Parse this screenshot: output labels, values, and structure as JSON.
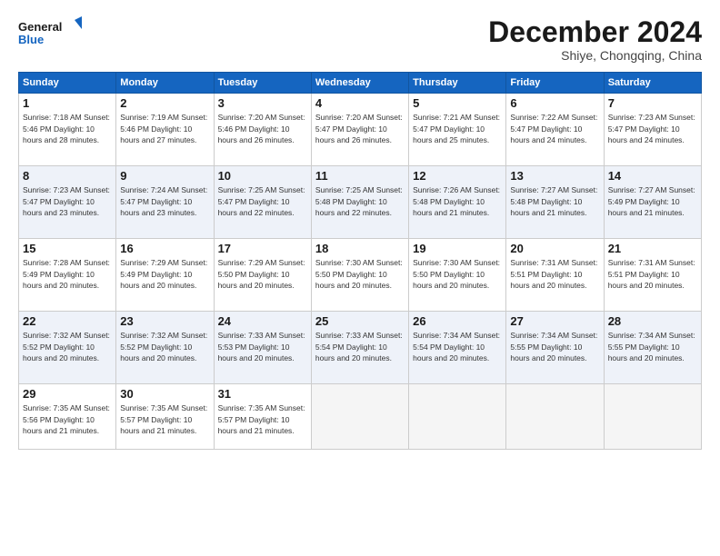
{
  "logo": {
    "line1": "General",
    "line2": "Blue"
  },
  "title": "December 2024",
  "subtitle": "Shiye, Chongqing, China",
  "days_header": [
    "Sunday",
    "Monday",
    "Tuesday",
    "Wednesday",
    "Thursday",
    "Friday",
    "Saturday"
  ],
  "weeks": [
    [
      {
        "day": "1",
        "info": "Sunrise: 7:18 AM\nSunset: 5:46 PM\nDaylight: 10 hours\nand 28 minutes."
      },
      {
        "day": "2",
        "info": "Sunrise: 7:19 AM\nSunset: 5:46 PM\nDaylight: 10 hours\nand 27 minutes."
      },
      {
        "day": "3",
        "info": "Sunrise: 7:20 AM\nSunset: 5:46 PM\nDaylight: 10 hours\nand 26 minutes."
      },
      {
        "day": "4",
        "info": "Sunrise: 7:20 AM\nSunset: 5:47 PM\nDaylight: 10 hours\nand 26 minutes."
      },
      {
        "day": "5",
        "info": "Sunrise: 7:21 AM\nSunset: 5:47 PM\nDaylight: 10 hours\nand 25 minutes."
      },
      {
        "day": "6",
        "info": "Sunrise: 7:22 AM\nSunset: 5:47 PM\nDaylight: 10 hours\nand 24 minutes."
      },
      {
        "day": "7",
        "info": "Sunrise: 7:23 AM\nSunset: 5:47 PM\nDaylight: 10 hours\nand 24 minutes."
      }
    ],
    [
      {
        "day": "8",
        "info": "Sunrise: 7:23 AM\nSunset: 5:47 PM\nDaylight: 10 hours\nand 23 minutes."
      },
      {
        "day": "9",
        "info": "Sunrise: 7:24 AM\nSunset: 5:47 PM\nDaylight: 10 hours\nand 23 minutes."
      },
      {
        "day": "10",
        "info": "Sunrise: 7:25 AM\nSunset: 5:47 PM\nDaylight: 10 hours\nand 22 minutes."
      },
      {
        "day": "11",
        "info": "Sunrise: 7:25 AM\nSunset: 5:48 PM\nDaylight: 10 hours\nand 22 minutes."
      },
      {
        "day": "12",
        "info": "Sunrise: 7:26 AM\nSunset: 5:48 PM\nDaylight: 10 hours\nand 21 minutes."
      },
      {
        "day": "13",
        "info": "Sunrise: 7:27 AM\nSunset: 5:48 PM\nDaylight: 10 hours\nand 21 minutes."
      },
      {
        "day": "14",
        "info": "Sunrise: 7:27 AM\nSunset: 5:49 PM\nDaylight: 10 hours\nand 21 minutes."
      }
    ],
    [
      {
        "day": "15",
        "info": "Sunrise: 7:28 AM\nSunset: 5:49 PM\nDaylight: 10 hours\nand 20 minutes."
      },
      {
        "day": "16",
        "info": "Sunrise: 7:29 AM\nSunset: 5:49 PM\nDaylight: 10 hours\nand 20 minutes."
      },
      {
        "day": "17",
        "info": "Sunrise: 7:29 AM\nSunset: 5:50 PM\nDaylight: 10 hours\nand 20 minutes."
      },
      {
        "day": "18",
        "info": "Sunrise: 7:30 AM\nSunset: 5:50 PM\nDaylight: 10 hours\nand 20 minutes."
      },
      {
        "day": "19",
        "info": "Sunrise: 7:30 AM\nSunset: 5:50 PM\nDaylight: 10 hours\nand 20 minutes."
      },
      {
        "day": "20",
        "info": "Sunrise: 7:31 AM\nSunset: 5:51 PM\nDaylight: 10 hours\nand 20 minutes."
      },
      {
        "day": "21",
        "info": "Sunrise: 7:31 AM\nSunset: 5:51 PM\nDaylight: 10 hours\nand 20 minutes."
      }
    ],
    [
      {
        "day": "22",
        "info": "Sunrise: 7:32 AM\nSunset: 5:52 PM\nDaylight: 10 hours\nand 20 minutes."
      },
      {
        "day": "23",
        "info": "Sunrise: 7:32 AM\nSunset: 5:52 PM\nDaylight: 10 hours\nand 20 minutes."
      },
      {
        "day": "24",
        "info": "Sunrise: 7:33 AM\nSunset: 5:53 PM\nDaylight: 10 hours\nand 20 minutes."
      },
      {
        "day": "25",
        "info": "Sunrise: 7:33 AM\nSunset: 5:54 PM\nDaylight: 10 hours\nand 20 minutes."
      },
      {
        "day": "26",
        "info": "Sunrise: 7:34 AM\nSunset: 5:54 PM\nDaylight: 10 hours\nand 20 minutes."
      },
      {
        "day": "27",
        "info": "Sunrise: 7:34 AM\nSunset: 5:55 PM\nDaylight: 10 hours\nand 20 minutes."
      },
      {
        "day": "28",
        "info": "Sunrise: 7:34 AM\nSunset: 5:55 PM\nDaylight: 10 hours\nand 20 minutes."
      }
    ],
    [
      {
        "day": "29",
        "info": "Sunrise: 7:35 AM\nSunset: 5:56 PM\nDaylight: 10 hours\nand 21 minutes."
      },
      {
        "day": "30",
        "info": "Sunrise: 7:35 AM\nSunset: 5:57 PM\nDaylight: 10 hours\nand 21 minutes."
      },
      {
        "day": "31",
        "info": "Sunrise: 7:35 AM\nSunset: 5:57 PM\nDaylight: 10 hours\nand 21 minutes."
      },
      null,
      null,
      null,
      null
    ]
  ]
}
